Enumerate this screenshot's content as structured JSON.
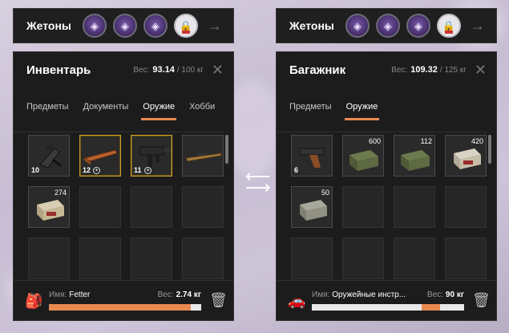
{
  "token_bars": [
    {
      "label": "Жетоны",
      "tokens": [
        "✦",
        "✦",
        "✦",
        "🔒"
      ]
    },
    {
      "label": "Жетоны",
      "tokens": [
        "✦",
        "✦",
        "✦",
        "🔒"
      ]
    }
  ],
  "inventory": {
    "title": "Инвентарь",
    "weight_label": "Вес:",
    "weight_value": "93.14",
    "weight_max": "/ 100 кг",
    "tabs": [
      "Предметы",
      "Документы",
      "Оружие",
      "Хобби"
    ],
    "active_tab": 2,
    "items": [
      {
        "icon": "crossbow-icon",
        "qty": "10",
        "count": "",
        "highlight": false,
        "marked": false,
        "warn": false
      },
      {
        "icon": "shotgun-icon",
        "qty": "12",
        "count": "",
        "highlight": true,
        "marked": true,
        "warn": true
      },
      {
        "icon": "smg-icon",
        "qty": "11",
        "count": "",
        "highlight": true,
        "marked": true,
        "warn": true
      },
      {
        "icon": "rifle-icon",
        "qty": "",
        "count": "",
        "highlight": false,
        "marked": false,
        "warn": false
      },
      {
        "icon": "ammo-box-icon",
        "qty": "",
        "count": "274",
        "highlight": false,
        "marked": false,
        "warn": false
      }
    ],
    "footer": {
      "name_label": "Имя:",
      "name": "Fetter",
      "weight_label": "Вес:",
      "weight": "2.74 кг",
      "load_fraction": 0.93,
      "icon": "backpack-icon"
    }
  },
  "trunk": {
    "title": "Багажник",
    "weight_label": "Вес:",
    "weight_value": "109.32",
    "weight_max": "/ 125 кг",
    "tabs": [
      "Предметы",
      "Оружие"
    ],
    "active_tab": 1,
    "items": [
      {
        "icon": "pistol-icon",
        "qty": "6",
        "count": ""
      },
      {
        "icon": "ammo-crate-icon",
        "qty": "",
        "count": "600"
      },
      {
        "icon": "ammo-crate-icon",
        "qty": "",
        "count": "112"
      },
      {
        "icon": "ammo-box-icon",
        "qty": "",
        "count": "420"
      },
      {
        "icon": "ammo-box-icon",
        "qty": "",
        "count": "50"
      }
    ],
    "footer": {
      "name_label": "Имя:",
      "name": "Оружейные инстр...",
      "weight_label": "Вес:",
      "weight": "90 кг",
      "load_fraction_main": 0.72,
      "load_fraction_extra": 0.12,
      "icon": "car-icon"
    }
  },
  "colors": {
    "accent": "#e88a50",
    "highlight": "#c9a02b",
    "panel": "#1c1c1c"
  }
}
